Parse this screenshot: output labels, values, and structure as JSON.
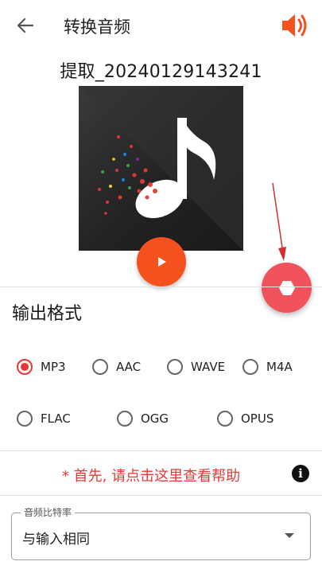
{
  "appbar": {
    "title": "转换音频",
    "back_icon": "arrow-left-icon",
    "speaker_icon": "volume-icon",
    "accent_color": "#f4511e"
  },
  "media": {
    "file_name": "提取_20240129143241",
    "cover_icon": "music-note-icon",
    "play_icon": "play-icon",
    "play_color": "#f4511e",
    "fab_icon": "hexagon-icon",
    "fab_color": "#f1525c"
  },
  "output": {
    "title": "输出格式",
    "selected": "MP3",
    "formats": [
      "MP3",
      "AAC",
      "WAVE",
      "M4A",
      "FLAC",
      "OGG",
      "OPUS"
    ],
    "radio_color": "#e53935"
  },
  "help": {
    "text": "* 首先, 请点击这里查看帮助",
    "info_icon": "info-icon"
  },
  "bitrate": {
    "label": "音频比特率",
    "value": "与输入相同",
    "caret_icon": "caret-down-icon"
  }
}
